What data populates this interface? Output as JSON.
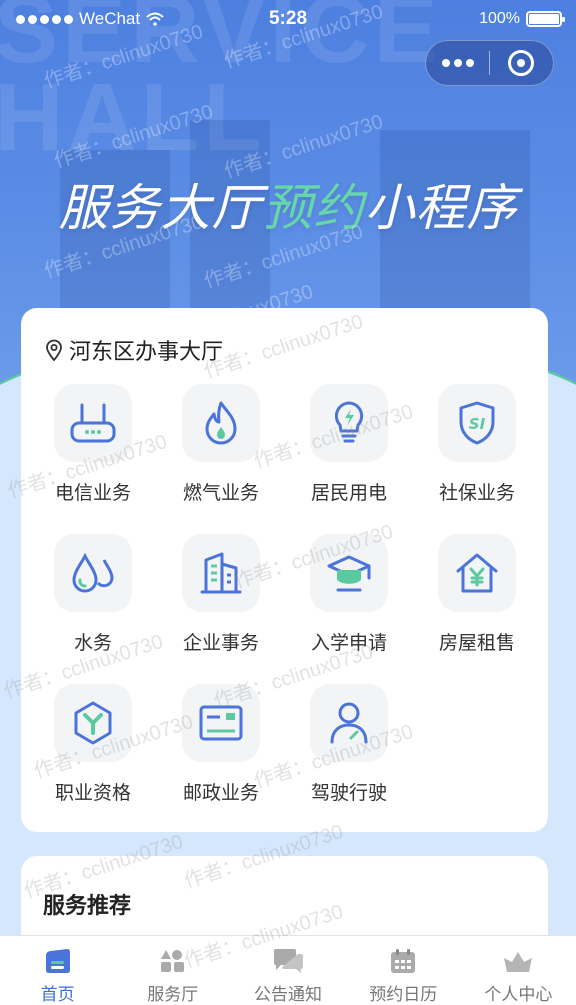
{
  "status_bar": {
    "carrier": "WeChat",
    "time": "5:28",
    "battery": "100%"
  },
  "hero": {
    "bg_text_line1": "SERVICE",
    "bg_text_line2": "HALL",
    "title_part1": "服务大厅",
    "title_highlight": "预约",
    "title_part2": "小程序"
  },
  "location": {
    "name": "河东区办事大厅"
  },
  "services": [
    {
      "label": "电信业务",
      "icon": "router-icon"
    },
    {
      "label": "燃气业务",
      "icon": "flame-icon"
    },
    {
      "label": "居民用电",
      "icon": "lightbulb-icon"
    },
    {
      "label": "社保业务",
      "icon": "si-shield-icon"
    },
    {
      "label": "水务",
      "icon": "water-drops-icon"
    },
    {
      "label": "企业事务",
      "icon": "building-icon"
    },
    {
      "label": "入学申请",
      "icon": "graduation-cap-icon"
    },
    {
      "label": "房屋租售",
      "icon": "house-yen-icon"
    },
    {
      "label": "职业资格",
      "icon": "hexagon-y-icon"
    },
    {
      "label": "邮政业务",
      "icon": "postal-card-icon"
    },
    {
      "label": "驾驶行驶",
      "icon": "driver-person-icon"
    }
  ],
  "recommend": {
    "title": "服务推荐"
  },
  "tabbar": [
    {
      "label": "首页",
      "icon": "home-icon",
      "active": true
    },
    {
      "label": "服务厅",
      "icon": "service-hall-icon",
      "active": false
    },
    {
      "label": "公告通知",
      "icon": "chat-notice-icon",
      "active": false
    },
    {
      "label": "预约日历",
      "icon": "calendar-icon",
      "active": false
    },
    {
      "label": "个人中心",
      "icon": "profile-crown-icon",
      "active": false
    }
  ],
  "watermark": "作者：cclinux0730",
  "colors": {
    "primary": "#3f6fd8",
    "accent": "#5ccaa0",
    "icon_blue": "#4a74d9"
  }
}
